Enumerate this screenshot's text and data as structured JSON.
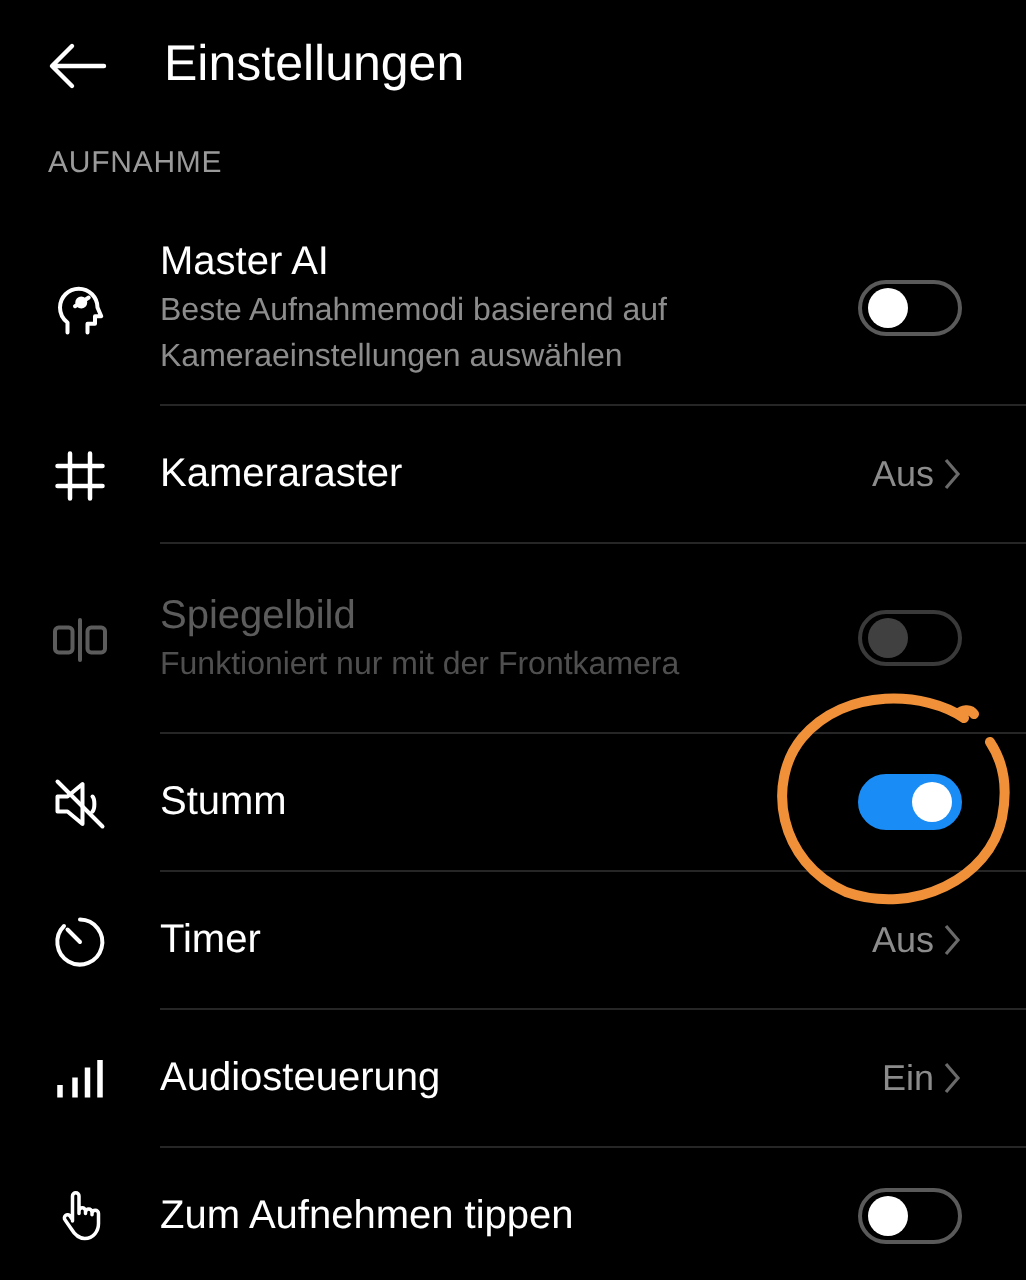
{
  "header": {
    "title": "Einstellungen"
  },
  "section": {
    "label": "AUFNAHME"
  },
  "rows": [
    {
      "kind": "toggle",
      "title": "Master AI",
      "subtitle": "Beste Aufnahmemodi basierend auf Kameraeinstellungen auswählen",
      "on": false,
      "disabled": false
    },
    {
      "kind": "value",
      "title": "Kameraraster",
      "value": "Aus",
      "disabled": false
    },
    {
      "kind": "toggle",
      "title": "Spiegelbild",
      "subtitle": "Funktioniert nur mit der Frontkamera",
      "on": false,
      "disabled": true
    },
    {
      "kind": "toggle",
      "title": "Stumm",
      "on": true,
      "disabled": false
    },
    {
      "kind": "value",
      "title": "Timer",
      "value": "Aus",
      "disabled": false
    },
    {
      "kind": "value",
      "title": "Audiosteuerung",
      "value": "Ein",
      "disabled": false
    },
    {
      "kind": "toggle",
      "title": "Zum Aufnehmen tippen",
      "on": false,
      "disabled": false
    }
  ]
}
